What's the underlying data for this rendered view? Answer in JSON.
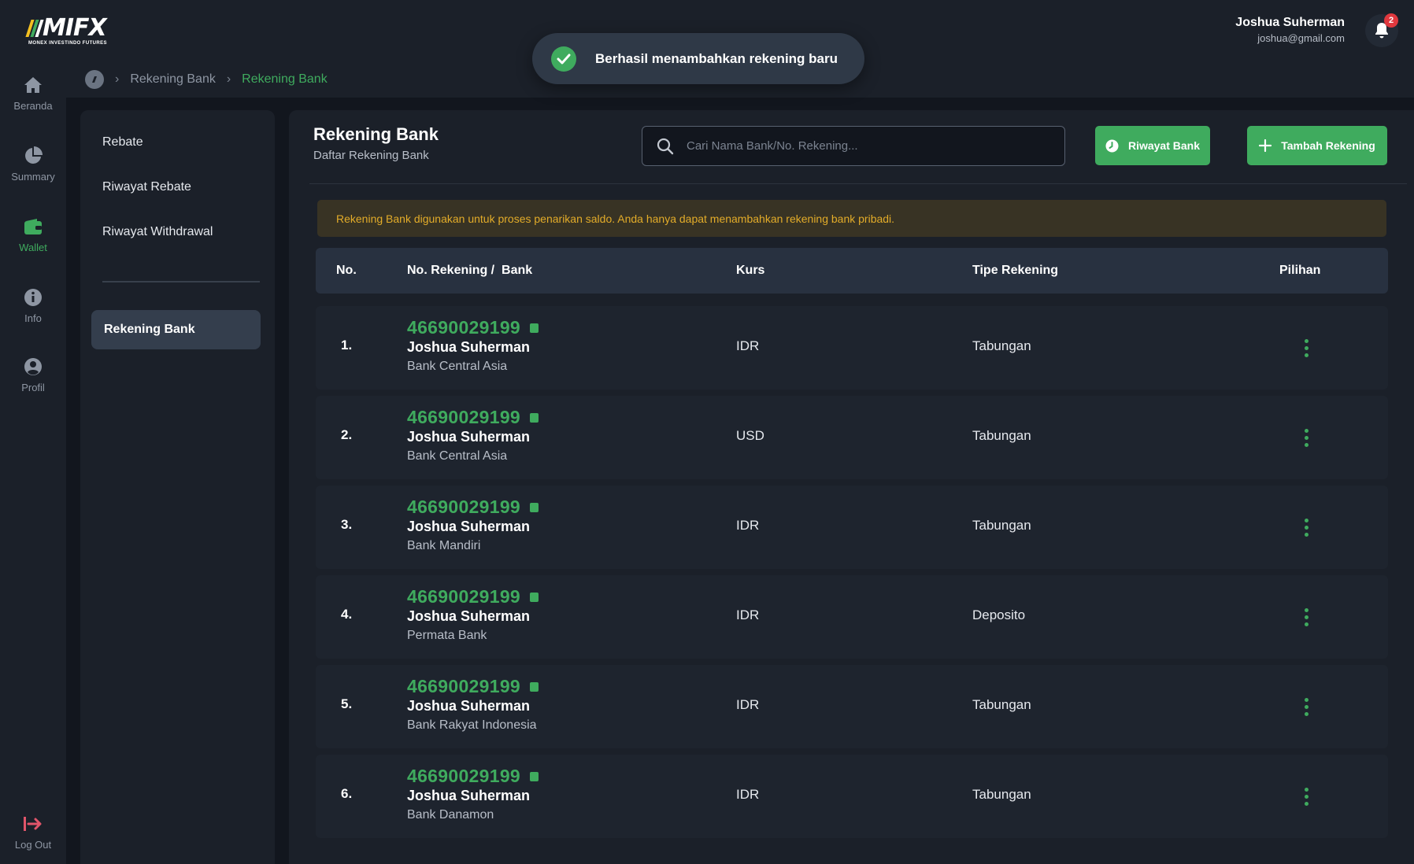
{
  "brand": {
    "logo_text": "MIFX",
    "logo_sub": "MONEX INVESTINDO FUTURES",
    "stripe_colors": [
      "#f4c020",
      "#3fab5e",
      "#ffffff"
    ]
  },
  "user": {
    "name": "Joshua Suherman",
    "email": "joshua@gmail.com",
    "notification_count": "2"
  },
  "toast": {
    "message": "Berhasil menambahkan rekening baru"
  },
  "rail": {
    "items": [
      {
        "label": "Beranda",
        "icon": "home-icon"
      },
      {
        "label": "Summary",
        "icon": "pie-chart-icon"
      },
      {
        "label": "Wallet",
        "icon": "wallet-icon",
        "active": true
      },
      {
        "label": "Info",
        "icon": "info-icon"
      },
      {
        "label": "Profil",
        "icon": "user-circle-icon"
      }
    ],
    "logout_label": "Log Out"
  },
  "breadcrumb": {
    "items": [
      "Rekening Bank",
      "Rekening Bank"
    ]
  },
  "submenu": {
    "items": [
      "Rebate",
      "Riwayat Rebate",
      "Riwayat Withdrawal"
    ],
    "active": "Rekening Bank"
  },
  "main": {
    "title": "Rekening Bank",
    "subtitle": "Daftar Rekening Bank",
    "search_placeholder": "Cari Nama Bank/No. Rekening...",
    "history_button": "Riwayat Bank",
    "add_button": "Tambah Rekening",
    "notice": "Rekening Bank digunakan untuk proses penarikan saldo. Anda hanya dapat menambahkan rekening bank pribadi."
  },
  "table": {
    "headers": {
      "no": "No.",
      "account": "No. Rekening /  Bank",
      "currency": "Kurs",
      "type": "Tipe Rekening",
      "options": "Pilihan"
    },
    "rows": [
      {
        "no": "1.",
        "account_number": "46690029199",
        "holder": "Joshua Suherman",
        "bank": "Bank Central Asia",
        "currency": "IDR",
        "type": "Tabungan"
      },
      {
        "no": "2.",
        "account_number": "46690029199",
        "holder": "Joshua Suherman",
        "bank": "Bank Central Asia",
        "currency": "USD",
        "type": "Tabungan"
      },
      {
        "no": "3.",
        "account_number": "46690029199",
        "holder": "Joshua Suherman",
        "bank": "Bank Mandiri",
        "currency": "IDR",
        "type": "Tabungan"
      },
      {
        "no": "4.",
        "account_number": "46690029199",
        "holder": "Joshua Suherman",
        "bank": "Permata Bank",
        "currency": "IDR",
        "type": "Deposito"
      },
      {
        "no": "5.",
        "account_number": "46690029199",
        "holder": "Joshua Suherman",
        "bank": "Bank Rakyat Indonesia",
        "currency": "IDR",
        "type": "Tabungan"
      },
      {
        "no": "6.",
        "account_number": "46690029199",
        "holder": "Joshua Suherman",
        "bank": "Bank Danamon",
        "currency": "IDR",
        "type": "Tabungan"
      }
    ]
  },
  "colors": {
    "accent": "#3fab5e",
    "warning_text": "#e3ac29",
    "badge": "#e0383e",
    "logout": "#e0556a"
  }
}
